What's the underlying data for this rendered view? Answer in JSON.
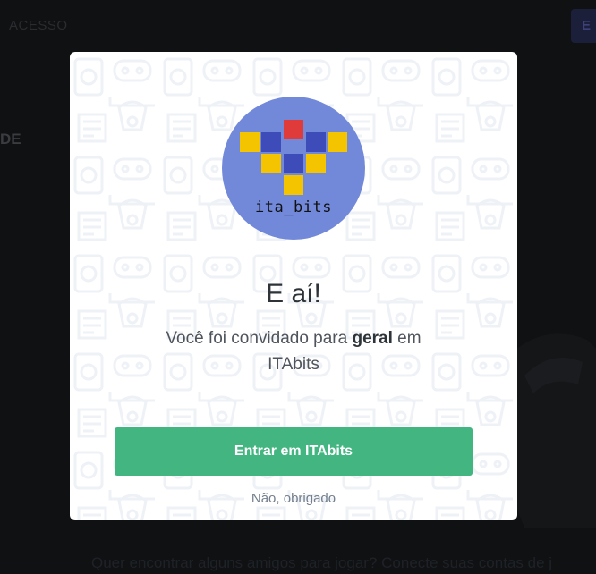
{
  "background": {
    "top_text": "ACESSO",
    "top_button_label": "E",
    "left_text": "DE",
    "bottom_text": "Quer encontrar alguns amigos para jogar? Conecte suas contas de j"
  },
  "invite_modal": {
    "avatar_text": "ita_bits",
    "title": "E aí!",
    "subtitle_prefix": "Você foi convidado para ",
    "channel_name": "geral",
    "subtitle_middle": " em ",
    "server_name": "ITAbits",
    "join_button_label": "Entrar em ITAbits",
    "decline_label": "Não, obrigado"
  },
  "colors": {
    "accent_green": "#43b581",
    "avatar_bg": "#7289da",
    "pixel_red": "#e03b3b",
    "pixel_blue": "#3d4cb8",
    "pixel_yellow": "#f5c400"
  }
}
